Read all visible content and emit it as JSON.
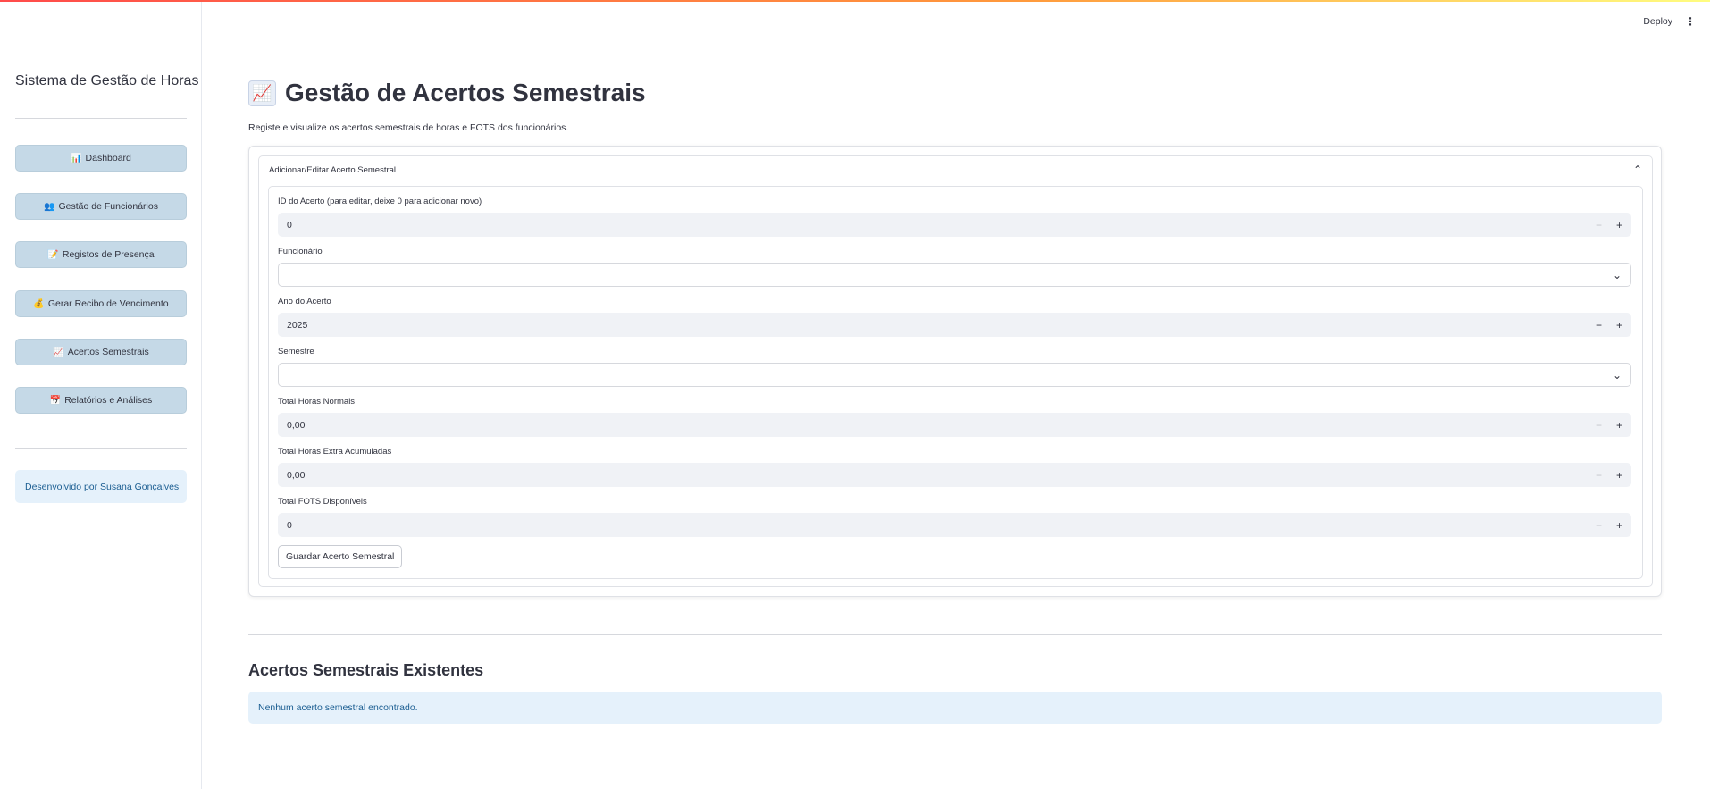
{
  "header": {
    "deploy_label": "Deploy",
    "menu_icon": "kebab-menu-icon"
  },
  "sidebar": {
    "title": "Sistema de Gestão de Horas",
    "items": [
      {
        "icon": "📊",
        "label": "Dashboard"
      },
      {
        "icon": "👥",
        "label": "Gestão de Funcionários"
      },
      {
        "icon": "📝",
        "label": "Registos de Presença"
      },
      {
        "icon": "💰",
        "label": "Gerar Recibo de Vencimento"
      },
      {
        "icon": "📈",
        "label": "Acertos Semestrais"
      },
      {
        "icon": "📅",
        "label": "Relatórios e Análises"
      }
    ],
    "footer_note": "Desenvolvido por Susana Gonçalves"
  },
  "main": {
    "title_icon": "📈",
    "title": "Gestão de Acertos Semestrais",
    "subtitle": "Registe e visualize os acertos semestrais de horas e FOTS dos funcionários.",
    "expander": {
      "label": "Adicionar/Editar Acerto Semestral",
      "fields": {
        "id_label": "ID do Acerto (para editar, deixe 0 para adicionar novo)",
        "id_value": "0",
        "funcionario_label": "Funcionário",
        "funcionario_value": "",
        "ano_label": "Ano do Acerto",
        "ano_value": "2025",
        "semestre_label": "Semestre",
        "semestre_value": "",
        "horas_normais_label": "Total Horas Normais",
        "horas_normais_value": "0,00",
        "horas_extra_label": "Total Horas Extra Acumuladas",
        "horas_extra_value": "0,00",
        "fots_label": "Total FOTS Disponíveis",
        "fots_value": "0"
      },
      "save_label": "Guardar Acerto Semestral"
    },
    "existing_title": "Acertos Semestrais Existentes",
    "empty_message": "Nenhum acerto semestral encontrado."
  },
  "colors": {
    "nav_button_bg": "#c5d9e7",
    "info_bg": "#e5f1fb",
    "info_text": "#1a5d91",
    "input_bg": "#f0f2f6"
  }
}
